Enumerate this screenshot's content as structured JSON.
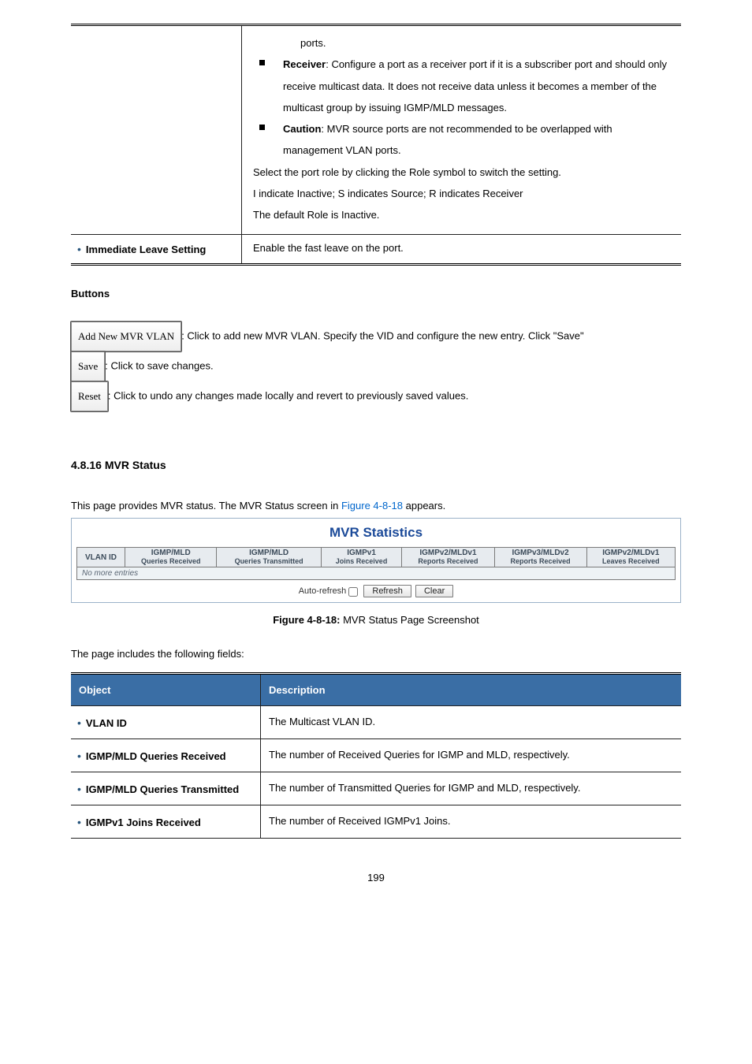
{
  "upper_table": {
    "row1_text_a": "ports.",
    "receiver_bold": "Receiver",
    "row1_receiver": ": Configure a port as a receiver port if it is a subscriber port and should only receive multicast data. It does not receive data unless it becomes a member of the multicast group by issuing IGMP/MLD messages.",
    "caution_bold": "Caution",
    "row1_caution": ": MVR source ports are not recommended to be overlapped with management VLAN ports.",
    "row1_tail_a": "Select the port role by clicking the Role symbol to switch the setting.",
    "row1_tail_b": "I indicate Inactive; S indicates Source; R indicates Receiver",
    "row1_tail_c": "The default Role is Inactive.",
    "row2_key": "Immediate Leave Setting",
    "row2_desc": "Enable the fast leave on the port."
  },
  "buttons_heading": "Buttons",
  "buttons": {
    "add_label": "Add New MVR VLAN",
    "add_desc": ": Click to add new MVR VLAN. Specify the VID and configure the new entry. Click \"Save\"",
    "save_label": "Save",
    "save_desc": ": Click to save changes.",
    "reset_label": "Reset",
    "reset_desc": ": Click to undo any changes made locally and revert to previously saved values."
  },
  "status_section_heading": "4.8.16 MVR Status",
  "status_intro_a": "This page provides MVR status. The MVR Status screen in ",
  "status_intro_link": "Figure 4-8-18",
  "status_intro_b": " appears.",
  "mvr_panel_title": "MVR Statistics",
  "mvr_headers": {
    "vlan": "VLAN ID",
    "c1a": "IGMP/MLD",
    "c1b": "Queries Received",
    "c2a": "IGMP/MLD",
    "c2b": "Queries Transmitted",
    "c3a": "IGMPv1",
    "c3b": "Joins Received",
    "c4a": "IGMPv2/MLDv1",
    "c4b": "Reports Received",
    "c5a": "IGMPv3/MLDv2",
    "c5b": "Reports Received",
    "c6a": "IGMPv2/MLDv1",
    "c6b": "Leaves Received"
  },
  "mvr_nomore": "No more entries",
  "mvr_controls": {
    "auto": "Auto-refresh",
    "refresh": "Refresh",
    "clear": "Clear"
  },
  "mvr_caption_a": "Figure 4-8-18:",
  "mvr_caption_b": " MVR Status Page Screenshot",
  "fields_intro": "The page includes the following fields:",
  "fields_header_a": "Object",
  "fields_header_b": "Description",
  "fields": {
    "r1k": "VLAN ID",
    "r1d": "The Multicast VLAN ID.",
    "r2k": "IGMP/MLD Queries Received",
    "r2d": "The number of Received Queries for IGMP and MLD, respectively.",
    "r3k": "IGMP/MLD Queries Transmitted",
    "r3d": "The number of Transmitted Queries for IGMP and MLD, respectively.",
    "r4k": "IGMPv1 Joins Received",
    "r4d": "The number of Received IGMPv1 Joins."
  },
  "page_number": "199",
  "chart_data": {
    "type": "table",
    "title": "MVR Statistics",
    "columns": [
      "VLAN ID",
      "IGMP/MLD Queries Received",
      "IGMP/MLD Queries Transmitted",
      "IGMPv1 Joins Received",
      "IGMPv2/MLDv1 Reports Received",
      "IGMPv3/MLDv2 Reports Received",
      "IGMPv2/MLDv1 Leaves Received"
    ],
    "rows": [],
    "empty_message": "No more entries"
  }
}
